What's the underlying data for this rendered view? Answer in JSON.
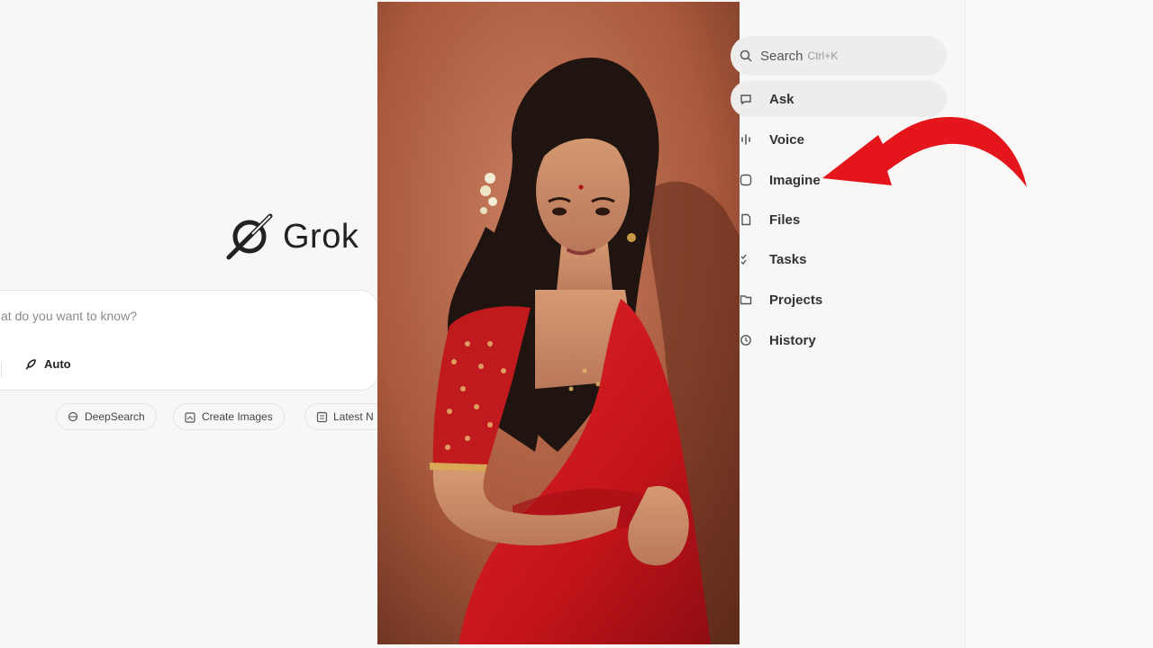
{
  "main": {
    "logo_text": "Grok",
    "ask_placeholder": "at do you want to know?",
    "mode_label": "Auto",
    "chips": [
      {
        "label": "DeepSearch",
        "icon": "deepsearch-icon"
      },
      {
        "label": "Create Images",
        "icon": "image-edit-icon"
      },
      {
        "label": "Latest N",
        "icon": "news-icon"
      }
    ]
  },
  "sidebar": {
    "search_label": "Search",
    "search_shortcut": "Ctrl+K",
    "items": [
      {
        "label": "Ask",
        "icon": "chat-icon",
        "active": true
      },
      {
        "label": "Voice",
        "icon": "voice-icon",
        "active": false
      },
      {
        "label": "Imagine",
        "icon": "image-icon",
        "active": false
      },
      {
        "label": "Files",
        "icon": "file-icon",
        "active": false
      },
      {
        "label": "Tasks",
        "icon": "tasks-icon",
        "active": false
      },
      {
        "label": "Projects",
        "icon": "folder-icon",
        "active": false
      },
      {
        "label": "History",
        "icon": "history-icon",
        "active": false
      }
    ]
  },
  "colors": {
    "arrow": "#e4161b",
    "saree": "#c8161c",
    "backdrop": "#b8684a"
  }
}
